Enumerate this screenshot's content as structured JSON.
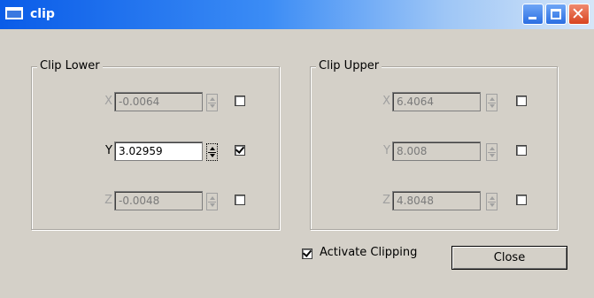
{
  "window": {
    "title": "clip"
  },
  "titlebar_buttons": {
    "minimize_icon": "minimize-icon",
    "maximize_icon": "maximize-icon",
    "close_icon": "close-icon",
    "close_glyph": "✕"
  },
  "clip_lower": {
    "legend": "Clip Lower",
    "rows": [
      {
        "axis": "X",
        "value": "-0.0064",
        "checked": false,
        "active": false
      },
      {
        "axis": "Y",
        "value": "3.02959",
        "checked": true,
        "active": true
      },
      {
        "axis": "Z",
        "value": "-0.0048",
        "checked": false,
        "active": false
      }
    ]
  },
  "clip_upper": {
    "legend": "Clip Upper",
    "rows": [
      {
        "axis": "X",
        "value": "6.4064",
        "checked": false,
        "active": false
      },
      {
        "axis": "Y",
        "value": "8.008",
        "checked": false,
        "active": false
      },
      {
        "axis": "Z",
        "value": "4.8048",
        "checked": false,
        "active": false
      }
    ]
  },
  "activate_clipping": {
    "label": "Activate Clipping",
    "checked": true
  },
  "close_button": {
    "label": "Close"
  },
  "colors": {
    "title_blue": "#0a5ce8",
    "face": "#d4d0c8",
    "disabled_text": "#a0a0a0"
  }
}
